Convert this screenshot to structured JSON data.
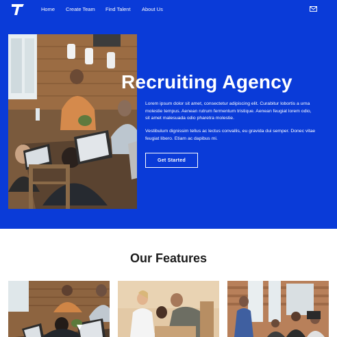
{
  "brand": {
    "logo_letter": "T",
    "accent": "#0a3bd8"
  },
  "nav": {
    "items": [
      {
        "label": "Home"
      },
      {
        "label": "Create Team"
      },
      {
        "label": "Find Talent"
      },
      {
        "label": "About Us"
      }
    ],
    "mail_icon": "mail-icon"
  },
  "hero": {
    "title": "Recruiting Agency",
    "paragraph1": "Lorem ipsum dolor sit amet, consectetur adipiscing elit. Curabitur lobortis a urna molestie tempus. Aenean rutrum fermentum tristique. Aenean feugiat lorem odio, sit amet malesuada odio pharetra molestie.",
    "paragraph2": "Vestibulum dignissim tellus ac lectus convallis, eu gravida dui semper. Donec vitae feugiat libero. Etiam ac dapibus mi.",
    "button_label": "Get Started"
  },
  "features": {
    "title": "Our Features"
  }
}
